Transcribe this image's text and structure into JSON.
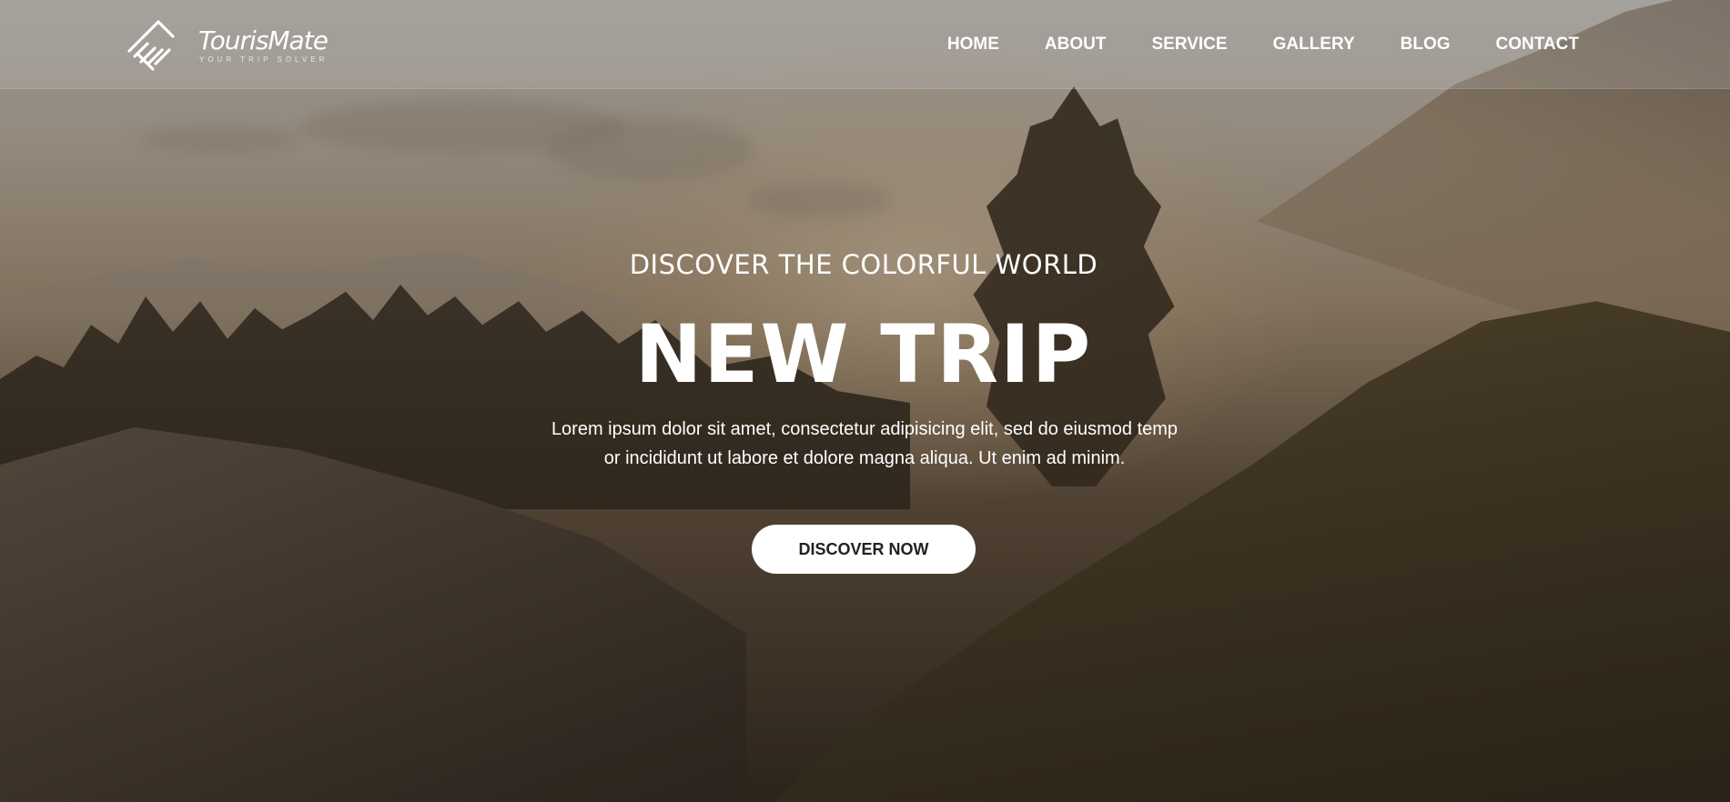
{
  "brand": {
    "name": "TourisMate",
    "tagline": "YOUR TRIP SOLVER",
    "logo_icon": "diagonal-stripes-arrow-icon"
  },
  "nav": {
    "items": [
      {
        "label": "HOME"
      },
      {
        "label": "ABOUT"
      },
      {
        "label": "SERVICE"
      },
      {
        "label": "GALLERY"
      },
      {
        "label": "BLOG"
      },
      {
        "label": "CONTACT"
      }
    ]
  },
  "hero": {
    "kicker": "DISCOVER THE COLORFUL WORLD",
    "title": "NEW TRIP",
    "description_line1": "Lorem ipsum dolor sit amet, consectetur adipisicing elit, sed do eiusmod temp",
    "description_line2": "or incididunt ut labore et dolore magna aliqua. Ut enim ad minim.",
    "cta_label": "DISCOVER NOW",
    "background": "mountain-forest-sunrise-photo"
  },
  "colors": {
    "text": "#ffffff",
    "button_bg": "#ffffff",
    "button_text": "#222222"
  }
}
